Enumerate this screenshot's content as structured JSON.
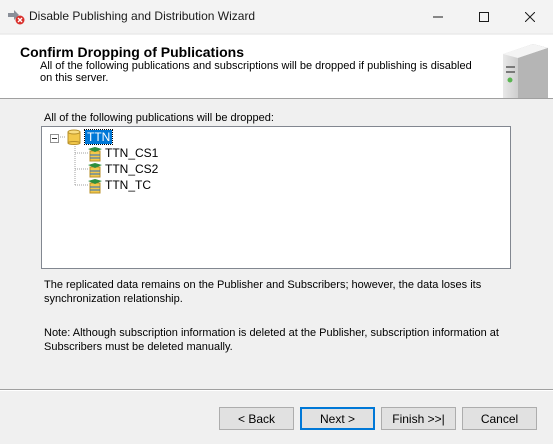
{
  "window": {
    "title": "Disable Publishing and Distribution Wizard",
    "app_icon": "wizard-disable-icon",
    "controls": {
      "minimize": "minimize-icon",
      "maximize": "maximize-icon",
      "close": "close-icon"
    }
  },
  "header": {
    "title": "Confirm Dropping of Publications",
    "description": "All of the following publications and subscriptions will be dropped if publishing is disabled on this server."
  },
  "main": {
    "list_label": "All of the following publications will be dropped:",
    "tree": {
      "root": {
        "label": "TTN",
        "expanded": true,
        "selected": true,
        "icon": "database-icon"
      },
      "children": [
        {
          "label": "TTN_CS1",
          "icon": "publication-icon"
        },
        {
          "label": "TTN_CS2",
          "icon": "publication-icon"
        },
        {
          "label": "TTN_TC",
          "icon": "publication-icon"
        }
      ]
    },
    "note_data": "The replicated data remains on the Publisher and Subscribers; however, the data loses its synchronization relationship.",
    "note_subscription": "Note: Although subscription information is deleted at the Publisher, subscription information at Subscribers must be deleted manually."
  },
  "footer": {
    "back_label": "< Back",
    "next_label": "Next >",
    "finish_label": "Finish >>|",
    "cancel_label": "Cancel"
  },
  "colors": {
    "selection": "#0078d7",
    "header_background": "#ffffff",
    "dialog_background": "#f0f0f0"
  }
}
